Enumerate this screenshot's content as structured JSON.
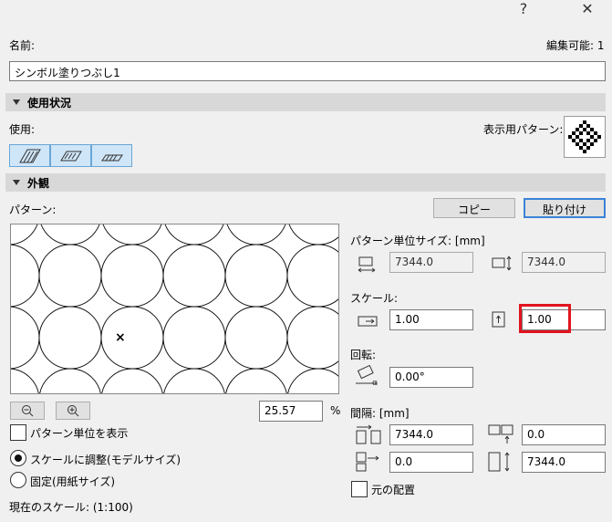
{
  "window": {
    "help_glyph": "?",
    "close_glyph": "✕"
  },
  "name_label": "名前:",
  "editable_label": "編集可能: 1",
  "name_value": "シンボル塗りつぶし1",
  "usage_section": {
    "title": "使用状況",
    "usage_label": "使用:",
    "display_pattern_label": "表示用パターン:"
  },
  "appearance_section": {
    "title": "外観"
  },
  "pattern_label": "パターン:",
  "copy_button": "コピー",
  "paste_button": "貼り付け",
  "unit_size": {
    "label": "パターン単位サイズ: [mm]",
    "width": "7344.0",
    "height": "7344.0"
  },
  "scale": {
    "label": "スケール:",
    "x": "1.00",
    "y": "1.00"
  },
  "rotation": {
    "label": "回転:",
    "value": "0.00°"
  },
  "spacing": {
    "label": "間隔: [mm]",
    "h1": "7344.0",
    "h2": "0.0",
    "v1": "0.0",
    "v2": "7344.0"
  },
  "zoom": {
    "value": "25.57",
    "unit": "%"
  },
  "show_unit_label": "パターン単位を表示",
  "radio_scale_model": "スケールに調整(モデルサイズ)",
  "radio_fixed_paper": "固定(用紙サイズ)",
  "current_scale": "現在のスケール: (1:100)",
  "origin_label": "元の配置",
  "colors": {
    "highlight": "#e1141e",
    "section_bar": "#d8d8d8",
    "accent": "#3b82d6"
  }
}
